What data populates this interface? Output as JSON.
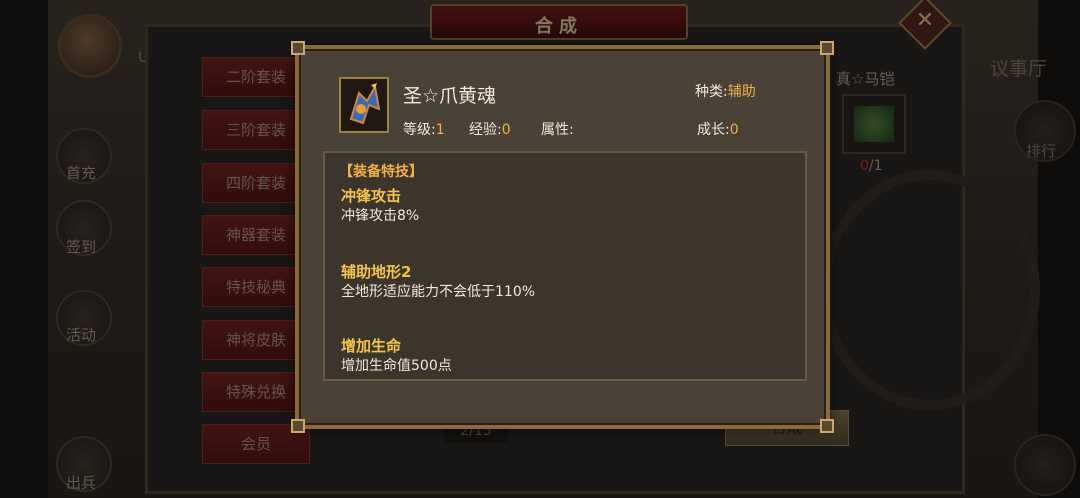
{
  "player": {
    "name": "UI"
  },
  "window": {
    "title": "合成",
    "close_glyph": "✕"
  },
  "menu": [
    {
      "label": "二阶套装"
    },
    {
      "label": "三阶套装"
    },
    {
      "label": "四阶套装"
    },
    {
      "label": "神器套装"
    },
    {
      "label": "特技秘典"
    },
    {
      "label": "神将皮肤"
    },
    {
      "label": "特殊兑换"
    },
    {
      "label": "会员"
    }
  ],
  "side_left": [
    "首充",
    "签到",
    "活动",
    "出兵"
  ],
  "side_right": {
    "hall": "议事厅",
    "rank": "排行"
  },
  "target_item": {
    "name": "真☆马铠",
    "count_have": "0",
    "count_need": "/1"
  },
  "pager": "2/15",
  "synth_button": "合成",
  "popup": {
    "item_name": "圣☆爪黄魂",
    "kind_label": "种类:",
    "kind_value": "辅助",
    "level_label": "等级:",
    "level_value": "1",
    "exp_label": "经验:",
    "exp_value": "0",
    "attr_label": "属性:",
    "growth_label": "成长:",
    "growth_value": "0",
    "skills_header": "【装备特技】",
    "skills": [
      {
        "name": "冲锋攻击",
        "desc": "冲锋攻击8%"
      },
      {
        "name": "辅助地形2",
        "desc": "全地形适应能力不会低于110%"
      },
      {
        "name": "增加生命",
        "desc": "增加生命值500点"
      }
    ]
  }
}
